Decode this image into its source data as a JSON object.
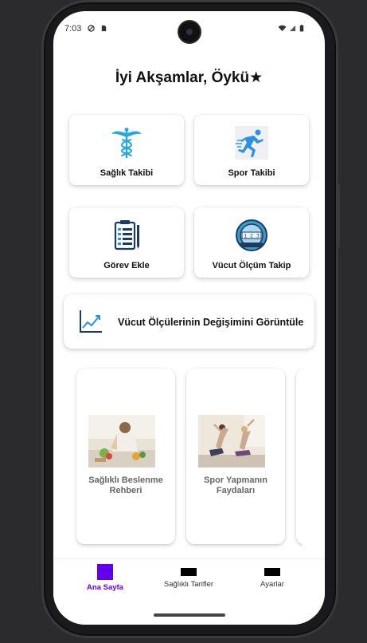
{
  "status_bar": {
    "time": "7:03"
  },
  "greeting": "İyi Akşamlar, Öykü★",
  "cards": [
    {
      "label": "Sağlık Takibi",
      "icon": "caduceus-icon"
    },
    {
      "label": "Spor Takibi",
      "icon": "runner-icon"
    },
    {
      "label": "Görev Ekle",
      "icon": "task-list-icon"
    },
    {
      "label": "Vücut Ölçüm Takip",
      "icon": "scale-icon"
    }
  ],
  "wide_card": {
    "label": "Vücut Ölçülerinin Değişimini Görüntüle",
    "icon": "trend-chart-icon"
  },
  "articles": [
    {
      "title": "Sağlıklı Beslenme Rehberi",
      "image": "healthy-food-photo"
    },
    {
      "title": "Spor Yapmanın Faydaları",
      "image": "exercise-photo"
    }
  ],
  "bottom_nav": [
    {
      "label": "Ana Sayfa",
      "active": true
    },
    {
      "label": "Sağlıklı Tarifler",
      "active": false
    },
    {
      "label": "Ayarlar",
      "active": false
    }
  ],
  "colors": {
    "accent": "#6200ee",
    "caduceus": "#29a8d9",
    "runner": "#2f8fe0",
    "ink": "#111111"
  }
}
